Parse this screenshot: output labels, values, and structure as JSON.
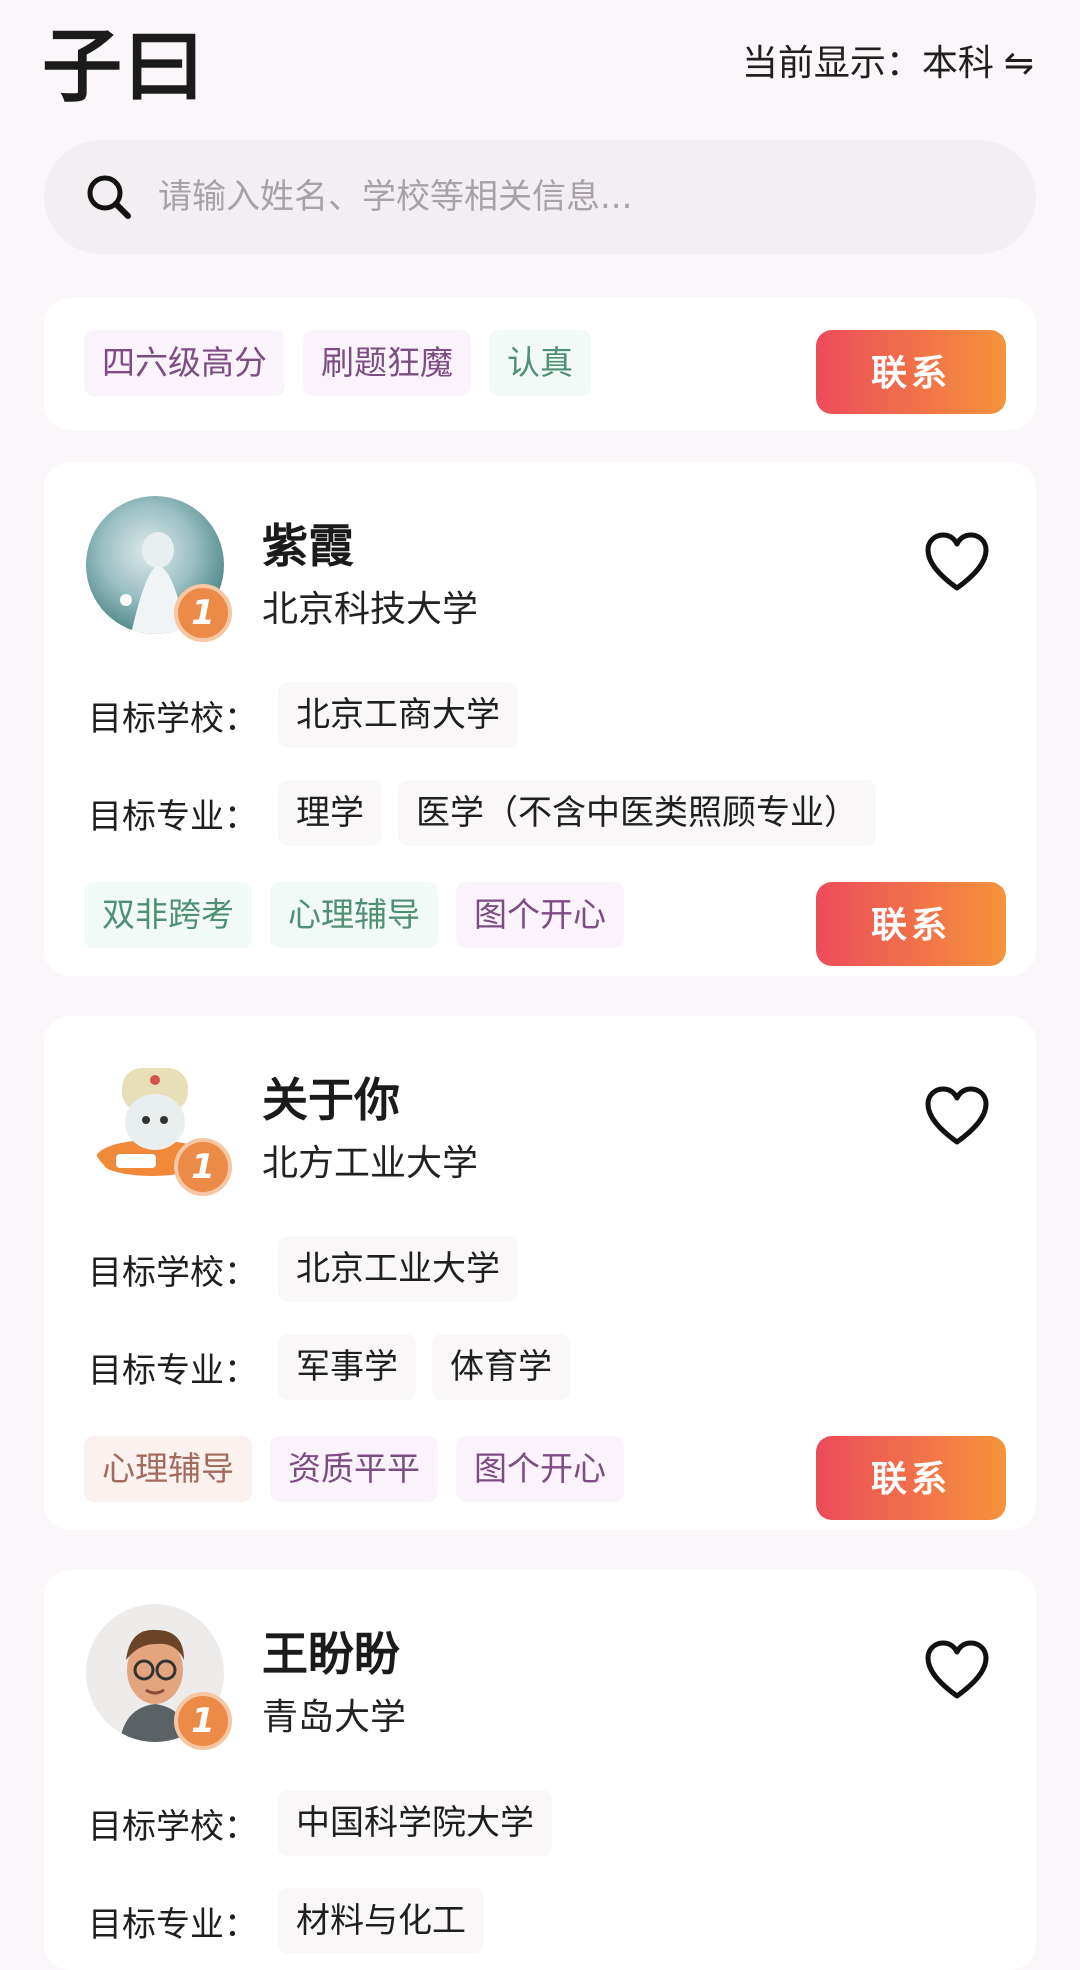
{
  "header": {
    "logo": "子曰",
    "mode_label": "当前显示：本科",
    "swap_glyph": "⇋"
  },
  "search": {
    "placeholder": "请输入姓名、学校等相关信息..."
  },
  "contact_label": "联系",
  "labels": {
    "target_school": "目标学校：",
    "target_major": "目标专业："
  },
  "top_card": {
    "tags": [
      "四六级高分",
      "刷题狂魔",
      "认真"
    ]
  },
  "cards": [
    {
      "name": "紫霞",
      "school": "北京科技大学",
      "rank": "1",
      "target_school": "北京工商大学",
      "majors": [
        "理学",
        "医学（不含中医类照顾专业）"
      ],
      "tags": [
        "双非跨考",
        "心理辅导",
        "图个开心"
      ]
    },
    {
      "name": "关于你",
      "school": "北方工业大学",
      "rank": "1",
      "target_school": "北京工业大学",
      "majors": [
        "军事学",
        "体育学"
      ],
      "tags": [
        "心理辅导",
        "资质平平",
        "图个开心"
      ]
    },
    {
      "name": "王盼盼",
      "school": "青岛大学",
      "rank": "1",
      "target_school": "中国科学院大学",
      "majors": [
        "材料与化工"
      ]
    }
  ]
}
